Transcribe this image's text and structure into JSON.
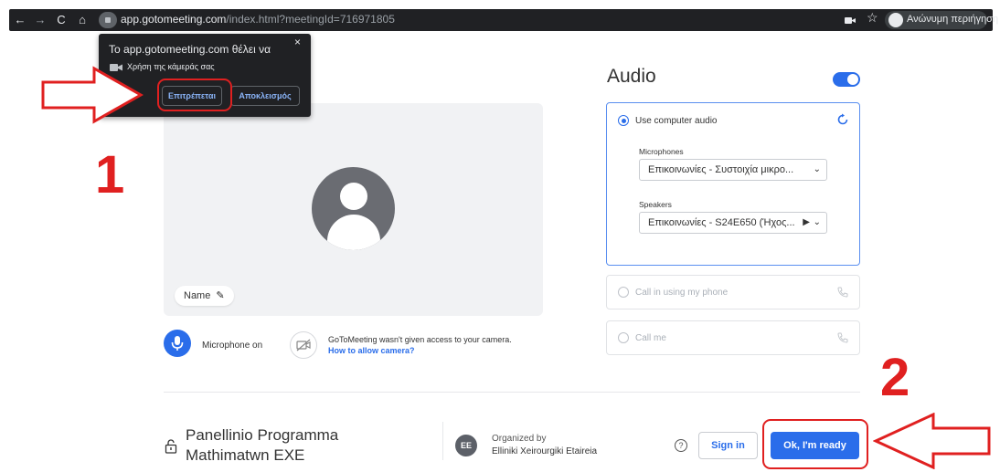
{
  "browser": {
    "url_host": "app.gotomeeting.com",
    "url_path": "/index.html?meetingId=716971805",
    "profile_label": "Ανώνυμη περιήγηση",
    "nav_icons": [
      "back-arrow-icon",
      "forward-arrow-icon",
      "reload-icon",
      "home-icon"
    ],
    "colors": {
      "toolbar": "#202124",
      "text": "#e8eaed"
    }
  },
  "permission_popup": {
    "title": "Το app.gotomeeting.com θέλει να",
    "description": "Χρήση της κάμεράς σας",
    "allow_label": "Επιτρέπεται",
    "block_label": "Αποκλεισμός",
    "close_glyph": "×"
  },
  "annotations": {
    "step1": "1",
    "step2": "2",
    "color": "#e02020"
  },
  "preview": {
    "name_label": "Name"
  },
  "controls": {
    "microphone_label": "Microphone on",
    "camera_message": "GoToMeeting wasn't given access to your camera.",
    "camera_link": "How to allow camera?"
  },
  "audio": {
    "title": "Audio",
    "computer_audio_label": "Use computer audio",
    "microphones_label": "Microphones",
    "microphone_value": "Επικοινωνίες - Συστοιχία μικρο...",
    "speakers_label": "Speakers",
    "speaker_value": "Επικοινωνίες - S24E650 (Ήχος...",
    "call_in_label": "Call in using my phone",
    "call_me_label": "Call me"
  },
  "footer": {
    "meeting_title": "Panellinio Programma Mathimatwn EXE",
    "organizer_initials": "EE",
    "organized_by_label": "Organized by",
    "organizer_name": "Elliniki Xeirourgiki Etaireia",
    "help_glyph": "?",
    "sign_in_label": "Sign in",
    "ready_label": "Ok, I'm ready"
  },
  "accent_color": "#2a6dea"
}
